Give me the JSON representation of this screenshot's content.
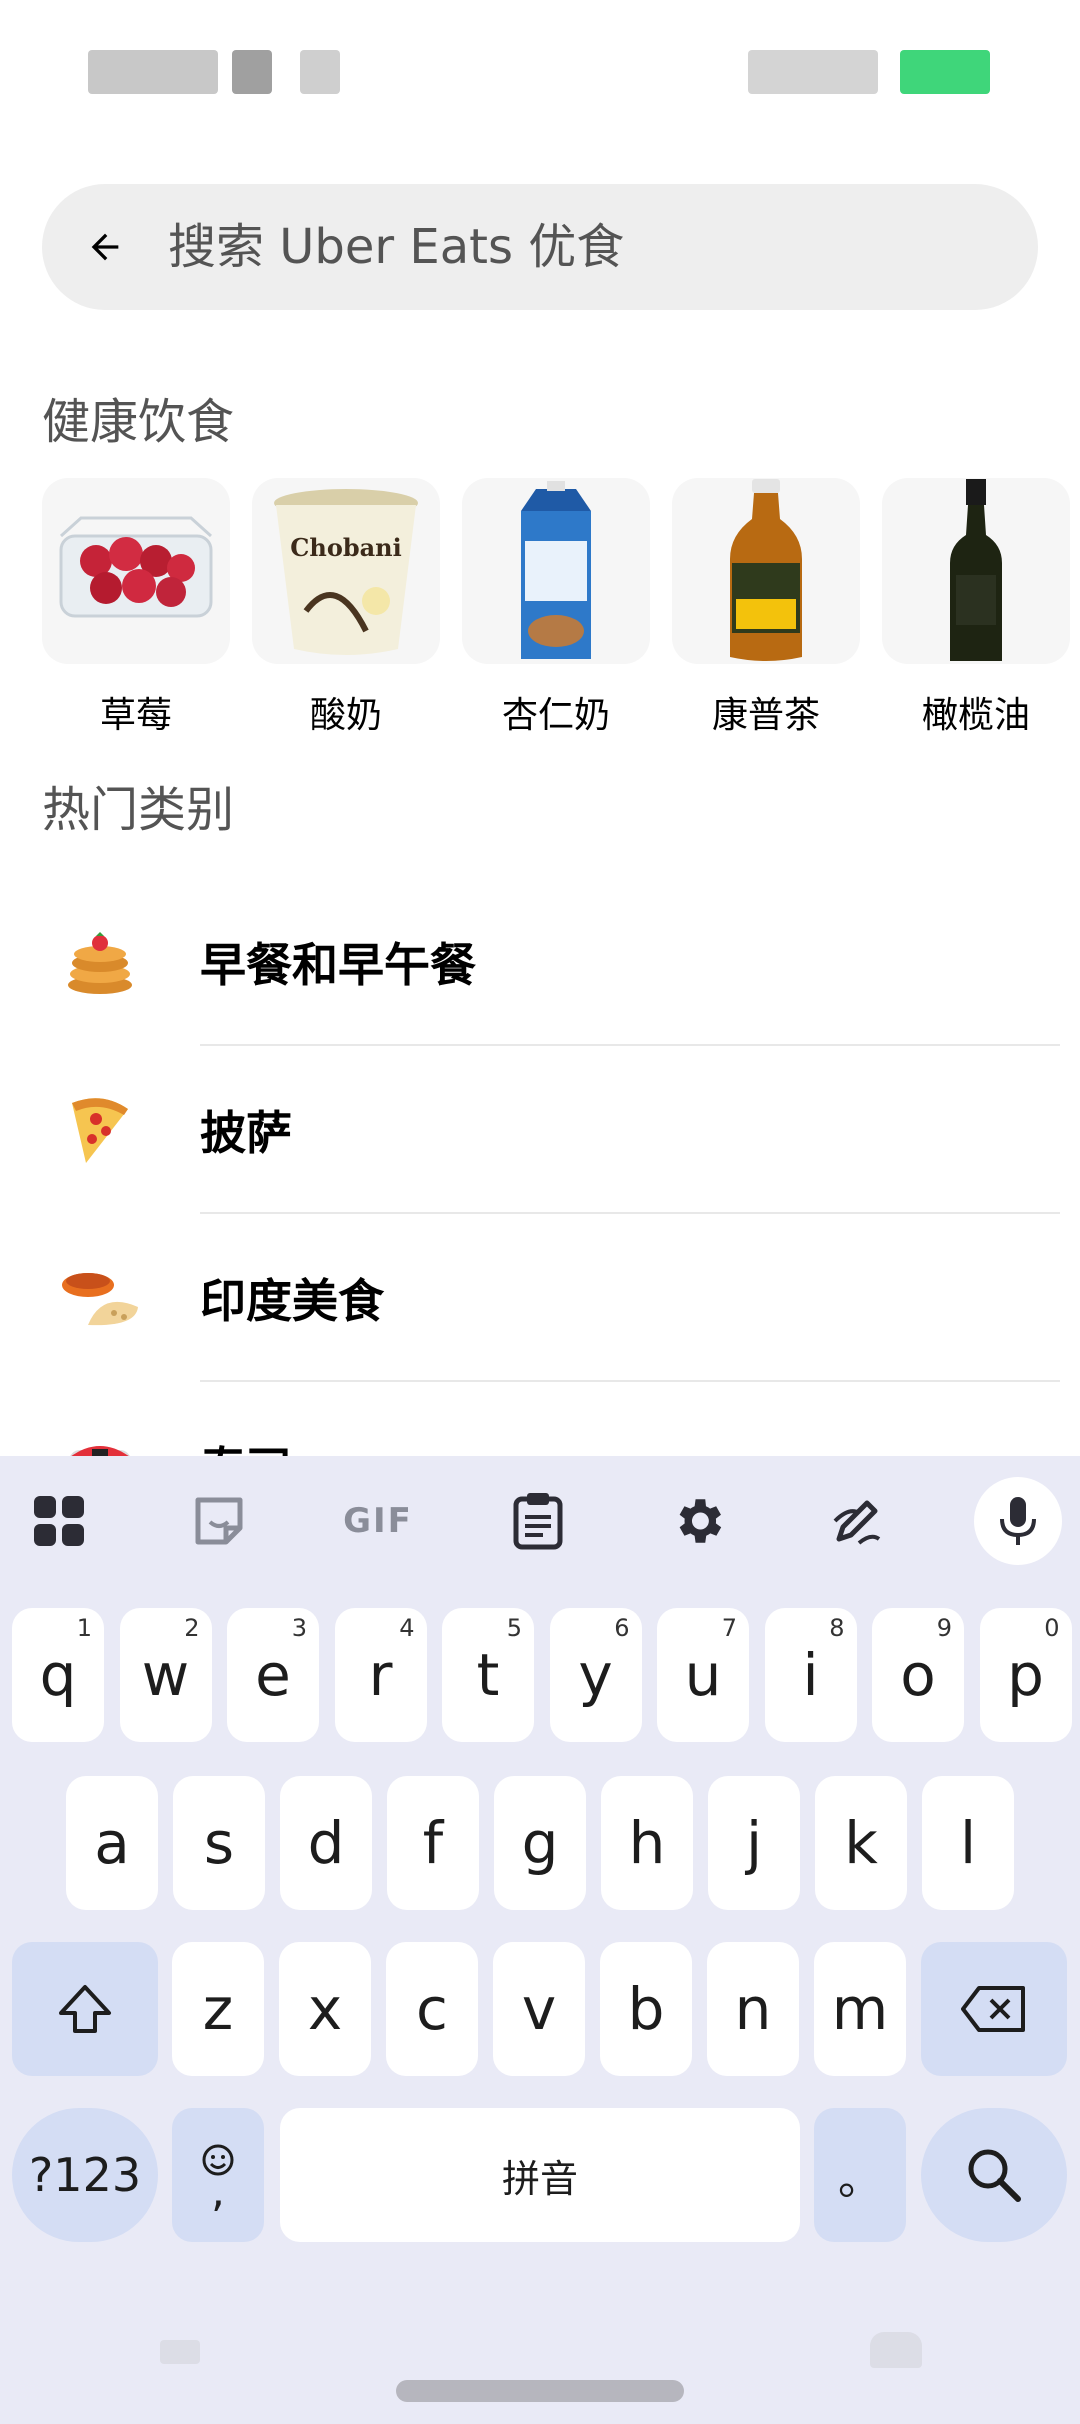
{
  "search": {
    "placeholder": "搜索 Uber Eats 优食"
  },
  "healthy": {
    "title": "健康饮食",
    "items": [
      {
        "label": "草莓"
      },
      {
        "label": "酸奶"
      },
      {
        "label": "杏仁奶"
      },
      {
        "label": "康普茶"
      },
      {
        "label": "橄榄油"
      }
    ]
  },
  "popular": {
    "title": "热门类别",
    "items": [
      {
        "label": "早餐和早午餐"
      },
      {
        "label": "披萨"
      },
      {
        "label": "印度美食"
      },
      {
        "label": "寿司"
      }
    ]
  },
  "keyboard": {
    "row1": [
      {
        "k": "q",
        "n": "1"
      },
      {
        "k": "w",
        "n": "2"
      },
      {
        "k": "e",
        "n": "3"
      },
      {
        "k": "r",
        "n": "4"
      },
      {
        "k": "t",
        "n": "5"
      },
      {
        "k": "y",
        "n": "6"
      },
      {
        "k": "u",
        "n": "7"
      },
      {
        "k": "i",
        "n": "8"
      },
      {
        "k": "o",
        "n": "9"
      },
      {
        "k": "p",
        "n": "0"
      }
    ],
    "row2": [
      "a",
      "s",
      "d",
      "f",
      "g",
      "h",
      "j",
      "k",
      "l"
    ],
    "row3": [
      "z",
      "x",
      "c",
      "v",
      "b",
      "n",
      "m"
    ],
    "symbols": "?123",
    "comma": ",",
    "space": "拼音",
    "period": "。",
    "toolbar_gif": "GIF"
  },
  "colors": {
    "accent_key": "#d4ddf4",
    "keyboard_bg": "#e9eaf6",
    "search_bg": "#eeeeee"
  }
}
